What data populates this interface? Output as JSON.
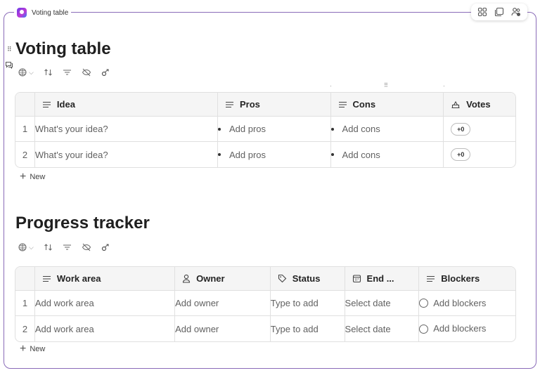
{
  "frame": {
    "title": "Voting table"
  },
  "voting": {
    "title": "Voting table",
    "columns": [
      "Idea",
      "Pros",
      "Cons",
      "Votes"
    ],
    "rows": [
      {
        "num": "1",
        "idea": "What's your idea?",
        "pros": "Add pros",
        "cons": "Add cons",
        "votes": "+0"
      },
      {
        "num": "2",
        "idea": "What's your idea?",
        "pros": "Add pros",
        "cons": "Add cons",
        "votes": "+0"
      }
    ],
    "new_label": "New"
  },
  "progress": {
    "title": "Progress tracker",
    "columns": [
      "Work area",
      "Owner",
      "Status",
      "End ...",
      "Blockers"
    ],
    "rows": [
      {
        "num": "1",
        "work": "Add work area",
        "owner": "Add owner",
        "status": "Type to add",
        "end": "Select date",
        "blockers": "Add blockers"
      },
      {
        "num": "2",
        "work": "Add work area",
        "owner": "Add owner",
        "status": "Type to add",
        "end": "Select date",
        "blockers": "Add blockers"
      }
    ],
    "new_label": "New"
  },
  "icons": [
    "loop-logo-icon",
    "loop-components-icon",
    "copy-icon",
    "share-people-icon",
    "drag-grip-icon",
    "comment-icon",
    "table-view-icon",
    "sort-icon",
    "filter-icon",
    "hide-icon",
    "share-icon",
    "text-column-icon",
    "votes-icon",
    "person-icon",
    "tag-icon",
    "calendar-icon",
    "plus-icon"
  ]
}
